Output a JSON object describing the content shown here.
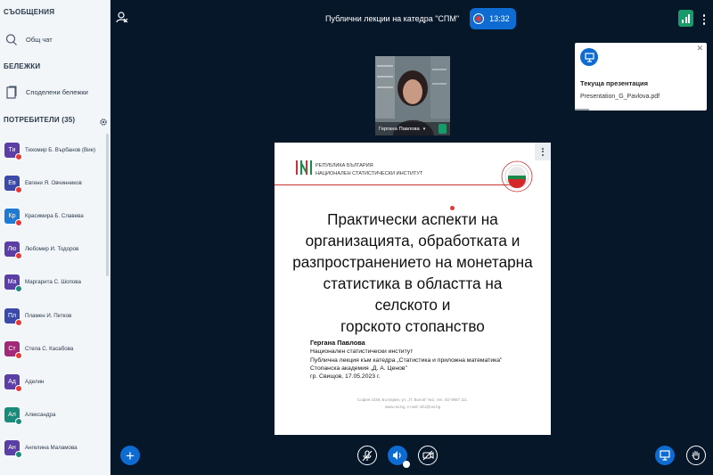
{
  "sidebar": {
    "messages_title": "СЪОБЩЕНИЯ",
    "public_chat_label": "Общ чат",
    "notes_title": "БЕЛЕЖКИ",
    "shared_notes_label": "Споделени бележки",
    "users_title": "ПОТРЕБИТЕЛИ (35)",
    "users": [
      {
        "initials": "Ти",
        "name": "Тихомир Б. Върбанов (Вие)",
        "color": "#5b3fa6",
        "status_color": "#e53935"
      },
      {
        "initials": "Ев",
        "name": "Евгени Я. Овчинников",
        "color": "#3b4aa8",
        "status_color": "#e53935"
      },
      {
        "initials": "Кр",
        "name": "Красимира Б. Славева",
        "color": "#1e7bd3",
        "status_color": "#e53935"
      },
      {
        "initials": "Лю",
        "name": "Любомир И. Тодоров",
        "color": "#5b3fa6",
        "status_color": "#e53935"
      },
      {
        "initials": "Ма",
        "name": "Маргарита С. Шопова",
        "color": "#5b3fa6",
        "status_color": "#1a8a7a"
      },
      {
        "initials": "Пл",
        "name": "Пламен И. Петков",
        "color": "#3b4aa8",
        "status_color": "#e53935"
      },
      {
        "initials": "Ст",
        "name": "Стела С. Касабова",
        "color": "#a3287a",
        "status_color": "#e53935"
      },
      {
        "initials": "Ад",
        "name": "Аделин",
        "color": "#5b3fa6",
        "status_color": "#e53935"
      },
      {
        "initials": "Ал",
        "name": "Александра",
        "color": "#1a8a7a",
        "status_color": "#1a8a7a"
      },
      {
        "initials": "Ан",
        "name": "Ангелина Маламова",
        "color": "#5b3fa6",
        "status_color": "#1a8a7a"
      }
    ]
  },
  "header": {
    "meeting_title": "Публични лекции на катедра \"СПМ\"",
    "recording_time": "13:32"
  },
  "webcam": {
    "name": "Гергана Павлова"
  },
  "presentation_card": {
    "title": "Текуща презентация",
    "filename": "Presentation_G_Pavlova.pdf"
  },
  "slide": {
    "org_line1": "РЕПУБЛИКА БЪЛГАРИЯ",
    "org_line2": "НАЦИОНАЛЕН СТАТИСТИЧЕСКИ ИНСТИТУТ",
    "title_lines": [
      "Практически аспекти на",
      "организацията, обработката  и",
      "разпространението на монетарна",
      "статистика в областта на селското и",
      "горското стопанство"
    ],
    "author_name": "Гергана Павлова",
    "author_lines": [
      "Национален статистически институт",
      "Публична лекция към катедра „Статистика и приложна математика\"",
      "Стопанска академия „Д. А. Ценов\"",
      "гр. Свищов, 17.05.2023 г."
    ],
    "contact_line1": "София 1038, България, ул. „П. Волов\" №2, тел. 02/ 9857 111,",
    "contact_line2": "www.nsi.bg, e-mail: info@nsi.bg"
  },
  "colors": {
    "background": "#06172a",
    "accent": "#0d6bd1",
    "recording_dot": "#e03b3b",
    "nsi_red": "#c93232"
  }
}
